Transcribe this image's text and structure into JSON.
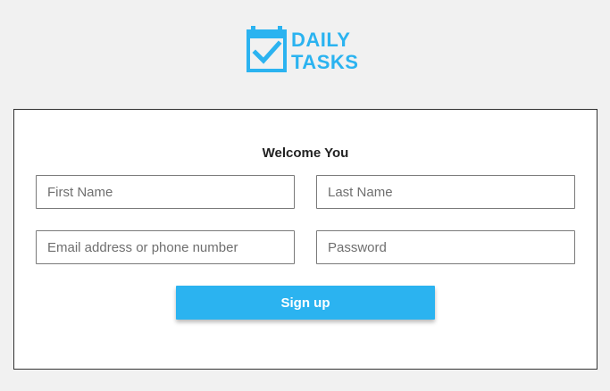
{
  "brand": {
    "line1": "DAILY",
    "line2": "TASKS",
    "color": "#2bb3f0",
    "icon": "calendar-check-icon"
  },
  "form": {
    "title": "Welcome You",
    "first_name_placeholder": "First Name",
    "last_name_placeholder": "Last Name",
    "email_placeholder": "Email address or phone number",
    "password_placeholder": "Password",
    "submit_label": "Sign up"
  },
  "colors": {
    "accent": "#2bb3f0",
    "background": "#f1f1f1",
    "card": "#ffffff"
  }
}
